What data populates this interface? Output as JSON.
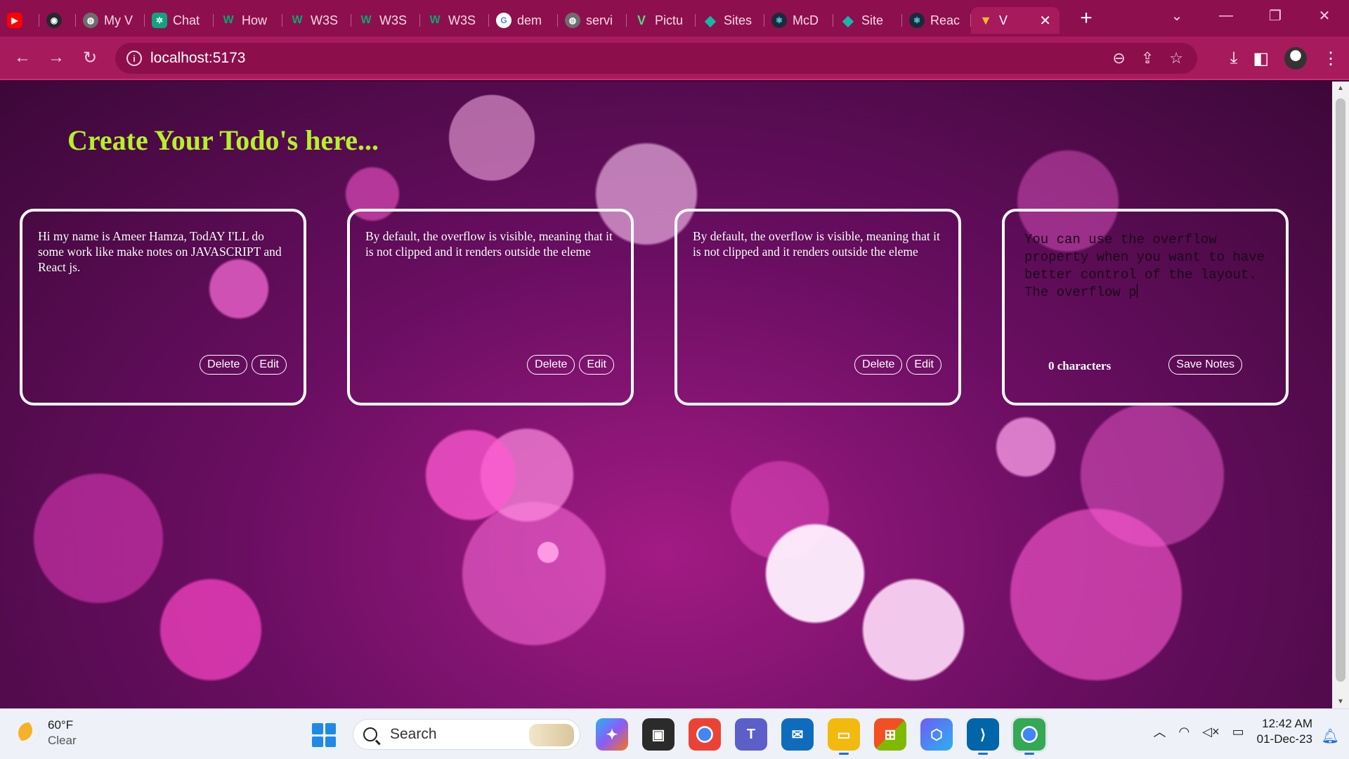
{
  "browser": {
    "tabs": [
      {
        "label": "",
        "icon": "youtube-icon",
        "color": "#ff0000",
        "glyph": "▶"
      },
      {
        "label": "",
        "icon": "github-icon",
        "color": "#24292f",
        "glyph": "◉"
      },
      {
        "label": "My V",
        "icon": "globe-icon",
        "color": "#6d6d6d",
        "glyph": "◍"
      },
      {
        "label": "Chat",
        "icon": "chatgpt-icon",
        "color": "#10a37f",
        "glyph": "✲"
      },
      {
        "label": "How",
        "icon": "w3schools-icon",
        "color": "#04aa6d",
        "glyph": "W"
      },
      {
        "label": "W3S",
        "icon": "w3schools-icon",
        "color": "#04aa6d",
        "glyph": "W"
      },
      {
        "label": "W3S",
        "icon": "w3schools-icon",
        "color": "#04aa6d",
        "glyph": "W"
      },
      {
        "label": "W3S",
        "icon": "w3schools-icon",
        "color": "#04aa6d",
        "glyph": "W"
      },
      {
        "label": "dem",
        "icon": "google-icon",
        "color": "#4285f4",
        "glyph": "G"
      },
      {
        "label": "servi",
        "icon": "globe-icon",
        "color": "#6d6d6d",
        "glyph": "◍"
      },
      {
        "label": "Pictu",
        "icon": "vuetify-icon",
        "color": "#1f8b4c",
        "glyph": "V"
      },
      {
        "label": "Sites",
        "icon": "diamond-icon",
        "color": "#14b8a6",
        "glyph": "◆"
      },
      {
        "label": "McD",
        "icon": "react-icon",
        "color": "#1b2a3a",
        "glyph": "⚛"
      },
      {
        "label": "Site",
        "icon": "diamond-icon",
        "color": "#14b8a6",
        "glyph": "◆"
      },
      {
        "label": "Reac",
        "icon": "react-icon",
        "color": "#1b2a3a",
        "glyph": "⚛"
      },
      {
        "label": "V",
        "icon": "vite-icon",
        "color": "#8b5cf6",
        "glyph": "▼",
        "active": true
      }
    ],
    "url": "localhost:5173"
  },
  "page": {
    "heading": "Create Your Todo's here...",
    "notes": [
      {
        "text": "Hi my name is Ameer Hamza, TodAY I'LL do some work like make notes on JAVASCRIPT and React js.",
        "delete_label": "Delete",
        "edit_label": "Edit"
      },
      {
        "text": "By default, the overflow is visible, meaning that it is not clipped and it renders outside the eleme",
        "delete_label": "Delete",
        "edit_label": "Edit"
      },
      {
        "text": "By default, the overflow is visible, meaning that it is not clipped and it renders outside the eleme",
        "delete_label": "Delete",
        "edit_label": "Edit"
      }
    ],
    "editor": {
      "value": "You can use the overflow property when you want to have better control of the layout. The overflow p",
      "counter": "0 characters",
      "save_label": "Save Notes"
    }
  },
  "taskbar": {
    "weather_temp": "60°F",
    "weather_desc": "Clear",
    "search_label": "Search",
    "time": "12:42 AM",
    "date": "01-Dec-23"
  }
}
